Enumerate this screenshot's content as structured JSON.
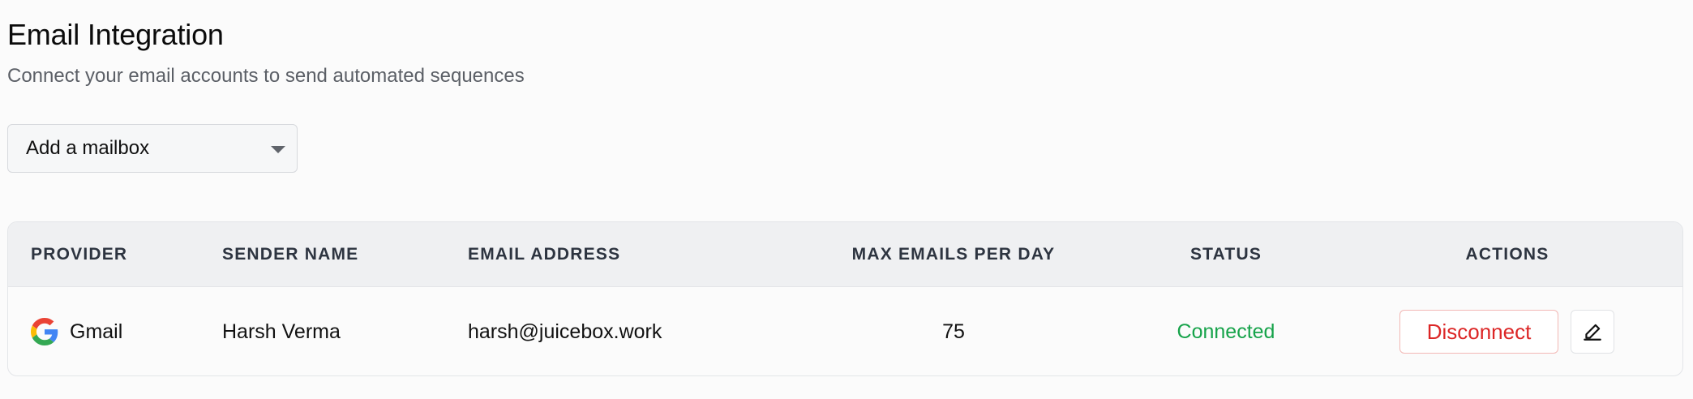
{
  "header": {
    "title": "Email Integration",
    "subtitle": "Connect your email accounts to send automated sequences"
  },
  "mailbox_select": {
    "selected": "Add a mailbox"
  },
  "table": {
    "columns": {
      "provider": "PROVIDER",
      "sender_name": "SENDER NAME",
      "email_address": "EMAIL ADDRESS",
      "max_emails": "MAX EMAILS PER DAY",
      "status": "STATUS",
      "actions": "ACTIONS"
    },
    "rows": [
      {
        "provider": "Gmail",
        "provider_icon": "google-g-icon",
        "sender_name": "Harsh Verma",
        "email_address": "harsh@juicebox.work",
        "max_emails": "75",
        "status": "Connected",
        "disconnect_label": "Disconnect",
        "edit_icon": "pen-signature-icon"
      }
    ]
  },
  "colors": {
    "status_connected": "#16a34a",
    "disconnect": "#dc2626",
    "header_bg": "#eff0f2"
  }
}
